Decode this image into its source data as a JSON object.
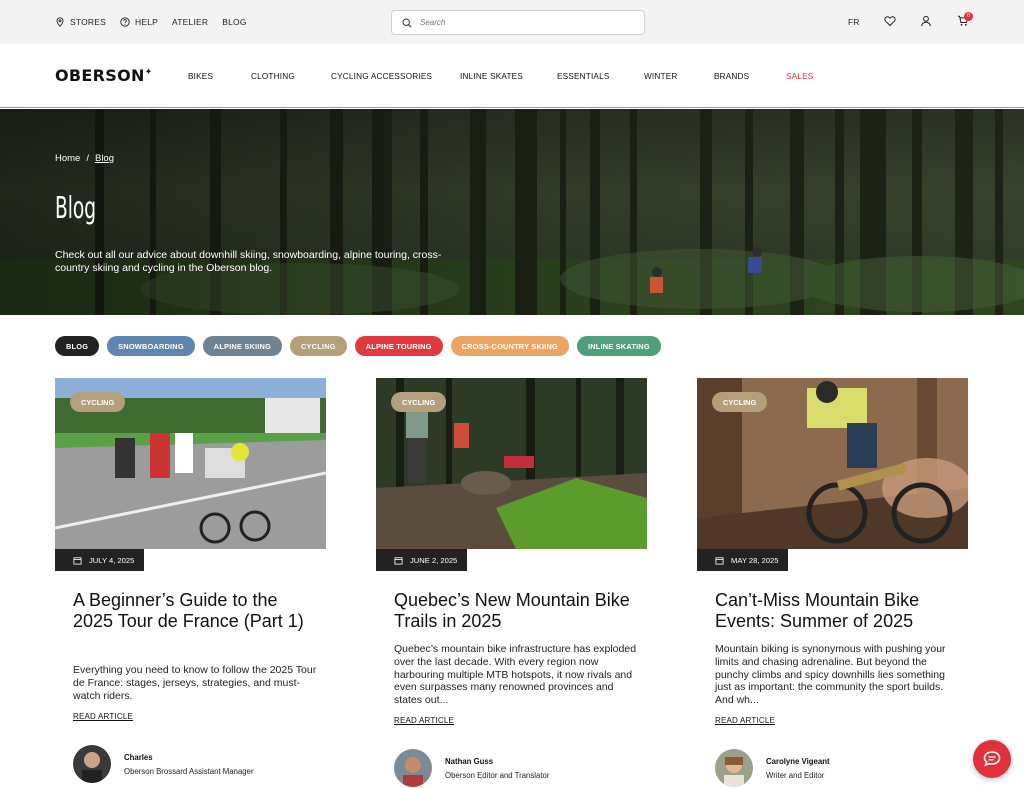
{
  "utility": {
    "stores": "STORES",
    "help": "HELP",
    "atelier": "ATELIER",
    "blog": "BLOG",
    "search_placeholder": "Search",
    "lang": "FR",
    "cart_count": "0"
  },
  "nav": {
    "logo": "OBERSON",
    "items": [
      "BIKES",
      "CLOTHING",
      "CYCLING ACCESSORIES",
      "INLINE SKATES",
      "ESSENTIALS",
      "WINTER",
      "BRANDS",
      "SALES"
    ]
  },
  "hero": {
    "breadcrumb_home": "Home",
    "breadcrumb_sep": "/",
    "breadcrumb_current": "Blog",
    "title": "Blog",
    "description": "Check out all our advice about downhill skiing, snowboarding, alpine touring, cross-country skiing and cycling in the Oberson blog."
  },
  "categories": [
    {
      "label": "BLOG",
      "color": "#222222"
    },
    {
      "label": "SNOWBOARDING",
      "color": "#5f86ae"
    },
    {
      "label": "ALPINE SKIING",
      "color": "#6f8393"
    },
    {
      "label": "CYCLING",
      "color": "#b3a07a"
    },
    {
      "label": "ALPINE TOURING",
      "color": "#e0393f"
    },
    {
      "label": "CROSS-COUNTRY SKIING",
      "color": "#eda362"
    },
    {
      "label": "INLINE SKATING",
      "color": "#4f9f7c"
    }
  ],
  "articles": [
    {
      "tag": "CYCLING",
      "date": "JULY 4, 2025",
      "title": "A Beginner’s Guide to the 2025 Tour de France (Part 1)",
      "excerpt": "Everything you need to know to follow the 2025 Tour de France: stages, jerseys, strategies, and must-watch riders.",
      "read": "READ ARTICLE",
      "author": "Charles",
      "role": "Oberson Brossard Assistant Manager"
    },
    {
      "tag": "CYCLING",
      "date": "JUNE 2, 2025",
      "title": "Quebec’s New Mountain Bike Trails in 2025",
      "excerpt": "Quebec’s mountain bike infrastructure has exploded over the last decade. With every region now harbouring multiple MTB hotspots, it now rivals and even surpasses many renowned provinces and states out...",
      "read": "READ ARTICLE",
      "author": "Nathan Guss",
      "role": "Oberson Editor and Translator"
    },
    {
      "tag": "CYCLING",
      "date": "MAY 28, 2025",
      "title": "Can’t-Miss Mountain Bike Events: Summer of 2025",
      "excerpt": "Mountain biking is synonymous with pushing your limits and chasing adrenaline. But beyond the punchy climbs and spicy downhills lies something just as important: the community the sport builds. And wh...",
      "read": "READ ARTICLE",
      "author": "Carolyne Vigeant",
      "role": "Writer and Editor"
    }
  ]
}
